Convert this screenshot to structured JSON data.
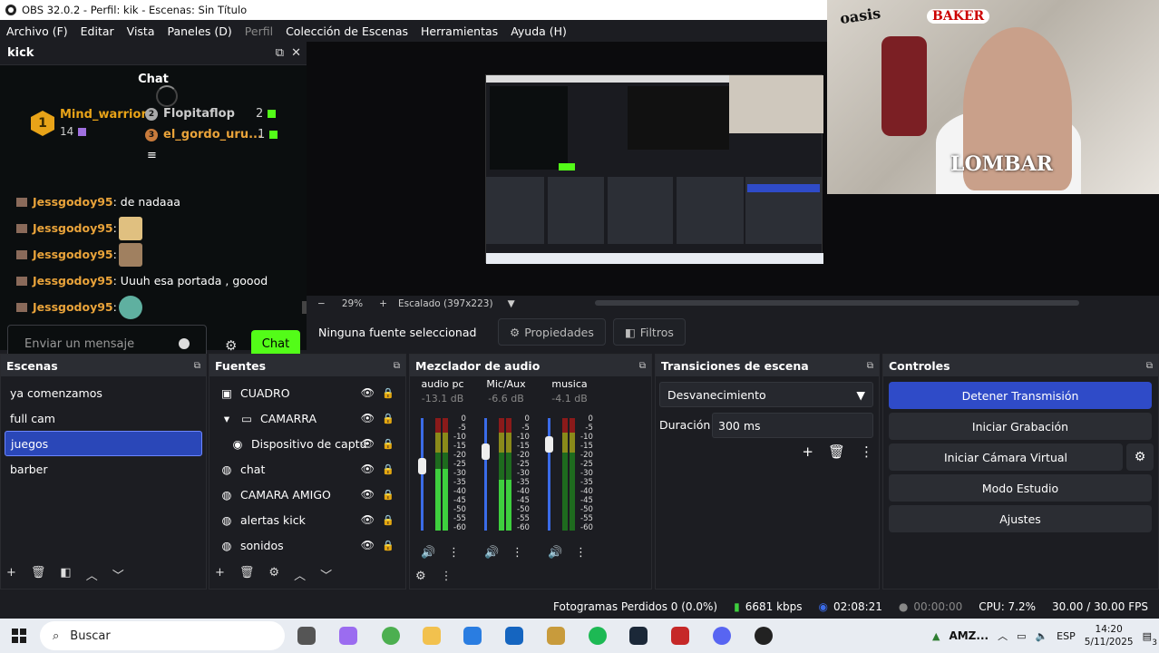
{
  "window": {
    "title": "OBS 32.0.2 - Perfil: kik - Escenas: Sin Título"
  },
  "menu": [
    "Archivo (F)",
    "Editar",
    "Vista",
    "Paneles (D)",
    "Perfil",
    "Colección de Escenas",
    "Herramientas",
    "Ayuda (H)"
  ],
  "kick_dock": {
    "title": "kick",
    "chat_title": "Chat",
    "leaderboard": {
      "first": {
        "rank": "1",
        "name": "Mind_warrior",
        "count": "14"
      },
      "second": {
        "rank": "2",
        "name": "Flopitaflop",
        "count": "2"
      },
      "third": {
        "rank": "3",
        "name": "el_gordo_uru...",
        "count": "1"
      }
    },
    "messages": [
      {
        "user": "Jessgodoy95",
        "text": ": de nadaaa"
      },
      {
        "user": "Jessgodoy95",
        "text": ":"
      },
      {
        "user": "Jessgodoy95",
        "text": ":"
      },
      {
        "user": "Jessgodoy95",
        "text": ": Uuuh esa portada , goood"
      },
      {
        "user": "Jessgodoy95",
        "text": ":"
      }
    ],
    "input_placeholder": "Enviar un mensaje",
    "send_label": "Chat"
  },
  "preview": {
    "zoom": "29%",
    "scale_label": "Escalado (397x223)"
  },
  "source_bar": {
    "none_selected": "Ninguna fuente seleccionad",
    "properties": "Propiedades",
    "filters": "Filtros"
  },
  "scenes": {
    "title": "Escenas",
    "items": [
      "ya comenzamos",
      "full cam",
      "juegos",
      "barber"
    ],
    "selected": "juegos"
  },
  "sources": {
    "title": "Fuentes",
    "items": [
      {
        "name": "CUADRO",
        "icon": "image-icon"
      },
      {
        "name": "CAMARRA",
        "icon": "folder-icon"
      },
      {
        "name": "Dispositivo de captu",
        "icon": "camera-icon"
      },
      {
        "name": "chat",
        "icon": "browser-icon"
      },
      {
        "name": "CAMARA AMIGO",
        "icon": "browser-icon"
      },
      {
        "name": "alertas kick",
        "icon": "browser-icon"
      },
      {
        "name": "sonidos",
        "icon": "browser-icon"
      }
    ]
  },
  "mixer": {
    "title": "Mezclador de audio",
    "channels": [
      {
        "name": "audio pc",
        "db": "-13.1 dB",
        "level": 0.55
      },
      {
        "name": "Mic/Aux",
        "db": "-6.6 dB",
        "level": 0.45
      },
      {
        "name": "musica",
        "db": "-4.1 dB",
        "level": 0.0
      }
    ],
    "scale": [
      "0",
      "-5",
      "-10",
      "-15",
      "-20",
      "-25",
      "-30",
      "-35",
      "-40",
      "-45",
      "-50",
      "-55",
      "-60"
    ]
  },
  "transitions": {
    "title": "Transiciones de escena",
    "selected": "Desvanecimiento",
    "duration_label": "Duración",
    "duration_value": "300 ms"
  },
  "controls": {
    "title": "Controles",
    "buttons": [
      "Detener Transmisión",
      "Iniciar Grabación",
      "Iniciar Cámara Virtual",
      "Modo Estudio",
      "Ajustes"
    ]
  },
  "status": {
    "dropped": "Fotogramas Perdidos 0 (0.0%)",
    "bitrate": "6681 kbps",
    "stream_time": "02:08:21",
    "rec_time": "00:00:00",
    "cpu": "CPU: 7.2%",
    "fps": "30.00 / 30.00 FPS"
  },
  "taskbar": {
    "search": "Buscar",
    "tray_text": "AMZ...",
    "lang": "ESP",
    "time": "14:20",
    "date": "5/11/2025",
    "notifications": "3"
  },
  "colors": {
    "accent": "#2f4bc8",
    "kick_green": "#53fc18",
    "username": "#e9a33a"
  }
}
